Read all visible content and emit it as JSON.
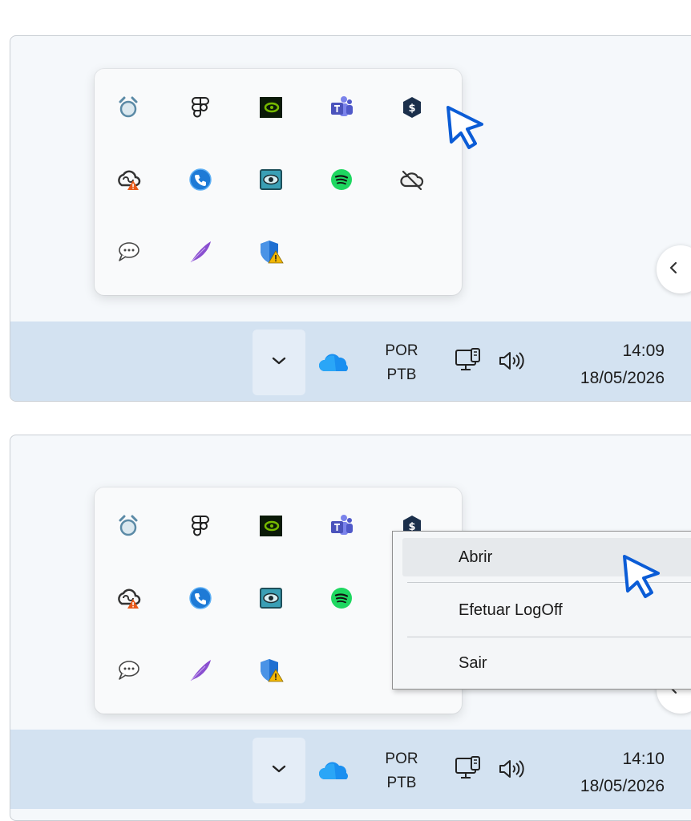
{
  "screens": [
    {
      "tray_icons": [
        "alarm-clock-icon",
        "figma-icon",
        "nvidia-icon",
        "teams-icon",
        "dollar-shield-icon",
        "creative-cloud-warning-icon",
        "phone-app-icon",
        "eye-screen-icon",
        "spotify-icon",
        "cloud-off-icon",
        "chat-bubble-icon",
        "feather-icon",
        "shield-warning-icon"
      ],
      "language": {
        "line1": "POR",
        "line2": "PTB"
      },
      "clock": {
        "time": "14:09",
        "date": "18/05/2026"
      }
    },
    {
      "tray_icons": [
        "alarm-clock-icon",
        "figma-icon",
        "nvidia-icon",
        "teams-icon",
        "dollar-shield-icon",
        "creative-cloud-warning-icon",
        "phone-app-icon",
        "eye-screen-icon",
        "spotify-icon",
        "chat-bubble-icon",
        "feather-icon",
        "shield-warning-icon"
      ],
      "language": {
        "line1": "POR",
        "line2": "PTB"
      },
      "clock": {
        "time": "14:10",
        "date": "18/05/2026"
      },
      "context_menu": {
        "items": [
          "Abrir",
          "Efetuar LogOff",
          "Sair"
        ],
        "hovered": "Abrir"
      }
    }
  ],
  "colors": {
    "taskbar": "#d3e2f1",
    "accent": "#0b5cd6"
  }
}
